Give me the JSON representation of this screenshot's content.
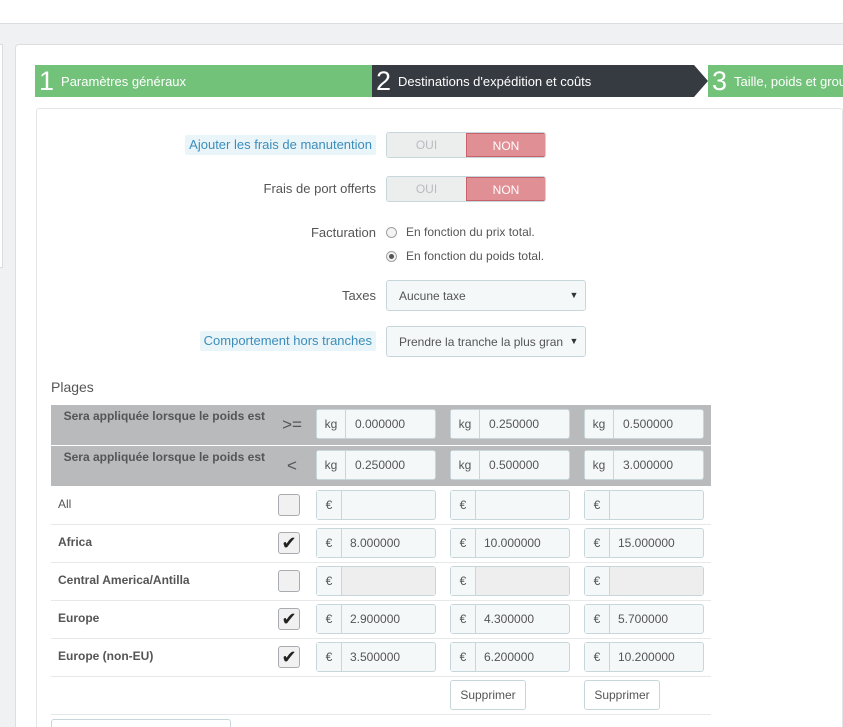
{
  "steps": [
    {
      "num": "1",
      "label": "Paramètres généraux"
    },
    {
      "num": "2",
      "label": "Destinations d'expédition et coûts"
    },
    {
      "num": "3",
      "label": "Taille, poids et groupes"
    }
  ],
  "form": {
    "handling": {
      "label": "Ajouter les frais de manutention",
      "on": "OUI",
      "off": "NON",
      "value": "NON"
    },
    "free_shipping": {
      "label": "Frais de port offerts",
      "on": "OUI",
      "off": "NON",
      "value": "NON"
    },
    "billing": {
      "label": "Facturation",
      "options": [
        "En fonction du prix total.",
        "En fonction du poids total."
      ],
      "selected": "En fonction du poids total."
    },
    "taxes": {
      "label": "Taxes",
      "value": "Aucune taxe"
    },
    "out_of_range": {
      "label": "Comportement hors tranches",
      "value": "Prendre la tranche la plus grande"
    }
  },
  "ranges": {
    "title": "Plages",
    "header_ge": {
      "text": "Sera appliquée lorsque le poids est",
      "op": ">=",
      "unit": "kg",
      "values": [
        "0.000000",
        "0.250000",
        "0.500000"
      ]
    },
    "header_lt": {
      "text": "Sera appliquée lorsque le poids est",
      "op": "<",
      "unit": "kg",
      "values": [
        "0.250000",
        "0.500000",
        "3.000000"
      ]
    },
    "currency": "€",
    "zones": [
      {
        "name": "All",
        "checked": false,
        "values": [
          "",
          "",
          ""
        ]
      },
      {
        "name": "Africa",
        "checked": true,
        "values": [
          "8.000000",
          "10.000000",
          "15.000000"
        ]
      },
      {
        "name": "Central America/Antilla",
        "checked": false,
        "values": [
          "",
          "",
          ""
        ]
      },
      {
        "name": "Europe",
        "checked": true,
        "values": [
          "2.900000",
          "4.300000",
          "5.700000"
        ]
      },
      {
        "name": "Europe (non-EU)",
        "checked": true,
        "values": [
          "3.500000",
          "6.200000",
          "10.200000"
        ]
      }
    ],
    "delete_label": "Supprimer",
    "check_mark": "✔"
  }
}
